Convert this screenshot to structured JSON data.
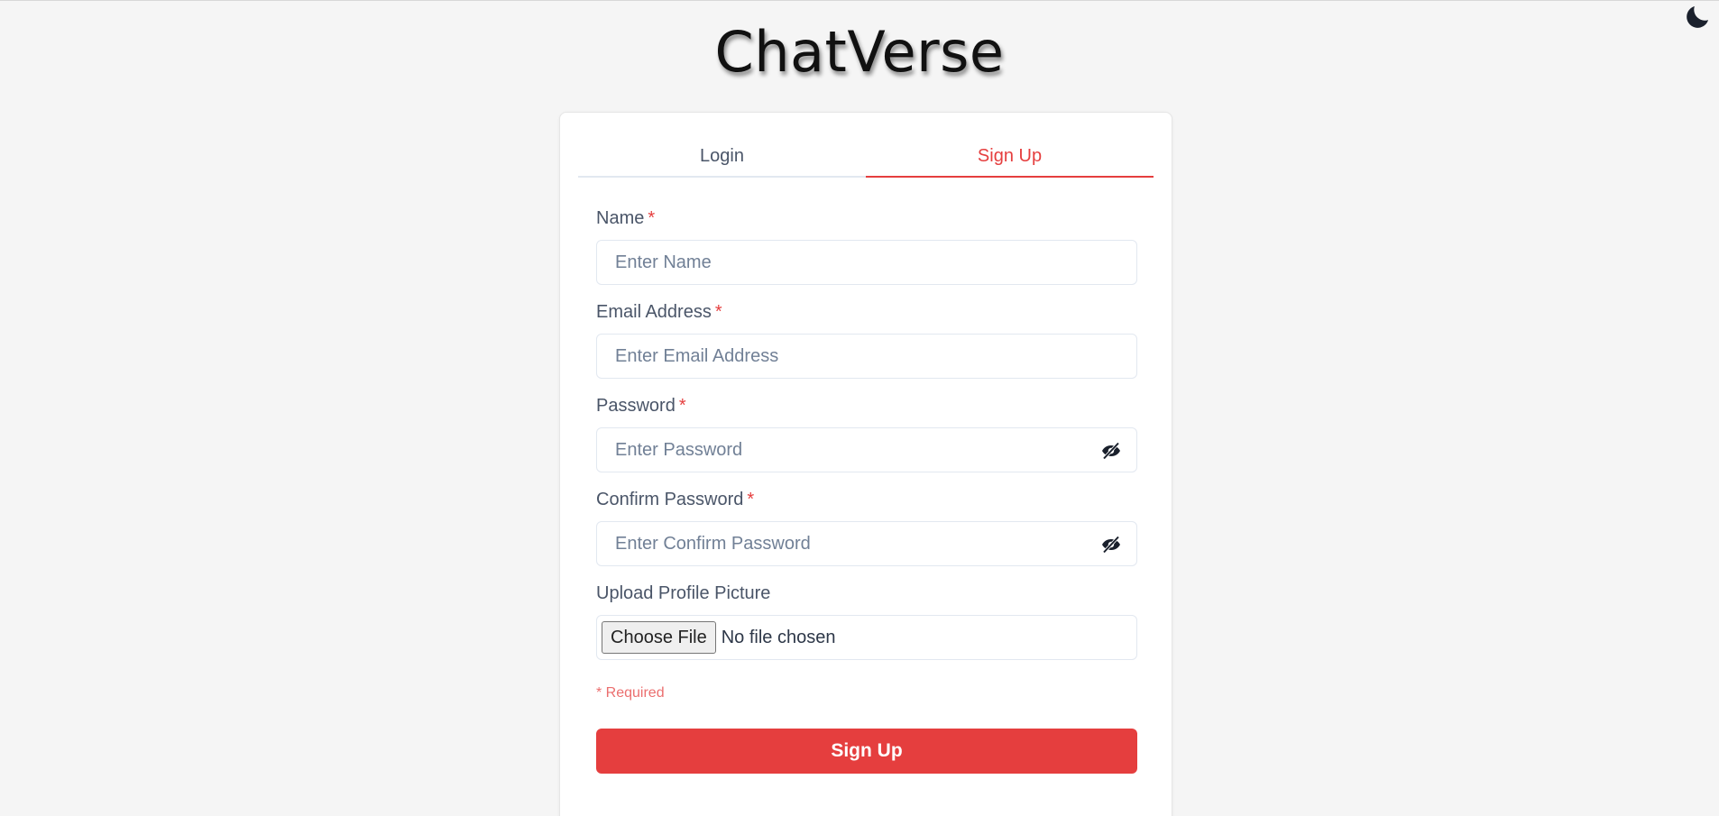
{
  "app": {
    "title": "ChatVerse"
  },
  "theme_toggle": {
    "icon": "moon-icon"
  },
  "tabs": [
    {
      "label": "Login",
      "active": false
    },
    {
      "label": "Sign Up",
      "active": true
    }
  ],
  "form": {
    "name": {
      "label": "Name",
      "required_mark": "*",
      "placeholder": "Enter Name",
      "value": ""
    },
    "email": {
      "label": "Email Address",
      "required_mark": "*",
      "placeholder": "Enter Email Address",
      "value": ""
    },
    "password": {
      "label": "Password",
      "required_mark": "*",
      "placeholder": "Enter Password",
      "value": "",
      "toggle_icon": "eye-slash-icon"
    },
    "confirm_password": {
      "label": "Confirm Password",
      "required_mark": "*",
      "placeholder": "Enter Confirm Password",
      "value": "",
      "toggle_icon": "eye-slash-icon"
    },
    "profile_picture": {
      "label": "Upload Profile Picture",
      "button_label": "Choose File",
      "status": "No file chosen"
    },
    "required_note": "* Required",
    "submit_label": "Sign Up"
  },
  "colors": {
    "accent": "#e53e3e",
    "background": "#f5f5f5",
    "card": "#ffffff",
    "text": "#4a5568",
    "placeholder": "#718096"
  }
}
